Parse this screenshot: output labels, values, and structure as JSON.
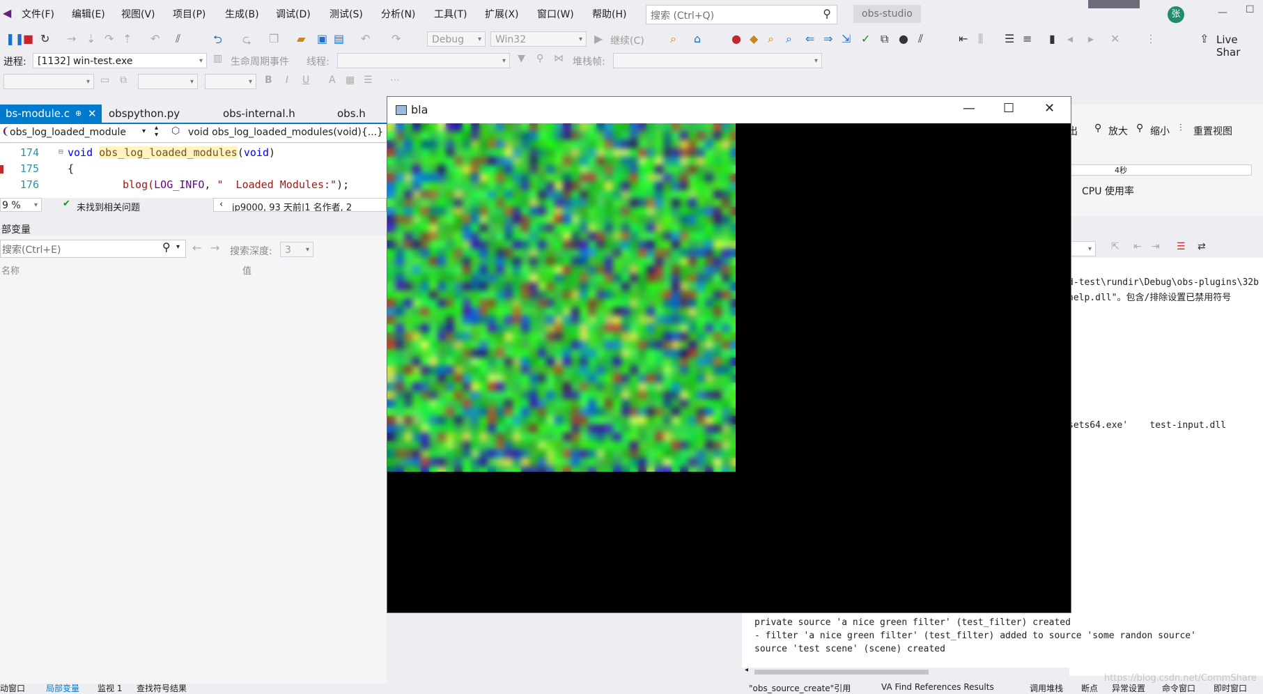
{
  "menu": {
    "items": [
      "文件(F)",
      "编辑(E)",
      "视图(V)",
      "项目(P)",
      "生成(B)",
      "调试(D)",
      "测试(S)",
      "分析(N)",
      "工具(T)",
      "扩展(X)",
      "窗口(W)",
      "帮助(H)"
    ],
    "search_placeholder": "搜索 (Ctrl+Q)",
    "solution": "obs-studio",
    "avatar": "张"
  },
  "toolbar": {
    "config": "Debug",
    "platform": "Win32",
    "continue": "继续(C)",
    "live_share": "Live Shar"
  },
  "procbar": {
    "process_label": "进程:",
    "process_value": "[1132] win-test.exe",
    "lifecycle": "生命周期事件",
    "thread_label": "线程:",
    "stack_label": "堆栈帧:"
  },
  "editor": {
    "tabs": [
      "bs-module.c",
      "obspython.py",
      "obs-internal.h",
      "obs.h"
    ],
    "nav_scope": "obs_log_loaded_module",
    "nav_member": "void obs_log_loaded_modules(void){...}",
    "lines": [
      {
        "num": "174"
      },
      {
        "num": "175"
      },
      {
        "num": "176"
      }
    ],
    "zoom": "9 %",
    "no_issues": "未找到相关问题",
    "blame": "jp9000, 93 天前|1 名作者, 2"
  },
  "code": {
    "l174_void": "void",
    "l174_fn": "obs_log_loaded_modules",
    "l174_paren_open": "(",
    "l174_void2": "void",
    "l174_paren_close": ")",
    "l175": "{",
    "l176_call": "blog(",
    "l176_macro": "LOG_INFO",
    "l176_comma": ", ",
    "l176_str": "\"  Loaded Modules:\"",
    "l176_end": ");"
  },
  "locals": {
    "title": "部变量",
    "search": "搜索(Ctrl+E)",
    "depth_label": "搜索深度:",
    "depth_value": "3",
    "col_name": "名称",
    "col_value": "值"
  },
  "diag": {
    "out_label": "出",
    "zoom_in": "放大",
    "zoom_out": "缩小",
    "reset_view": "重置视图",
    "time": "4秒",
    "cpu": "CPU 使用率"
  },
  "output": {
    "lines": [
      "d-test\\rundir\\Debug\\obs-plugins\\32b",
      "nelp.dll\"。包含/排除设置已禁用符号",
      "sets64.exe'    test-input.dll"
    ],
    "bottom_lines": [
      "private source 'a nice green filter' (test_filter) created",
      "- filter 'a nice green filter' (test_filter) added to source 'some randon source'",
      "source 'test scene' (scene) created"
    ]
  },
  "bottom_tabs": [
    "动窗口",
    "局部变量",
    "监视 1",
    "查找符号结果"
  ],
  "bottom_tabs_right": [
    "\"obs_source_create\"引用",
    "VA Find References Results",
    "调用堆栈",
    "断点",
    "异常设置",
    "命令窗口",
    "即时窗口"
  ],
  "watermark": "https://blog.csdn.net/CommShare",
  "window": {
    "title": "bla"
  },
  "colors": {
    "accent": "#007acc",
    "noise_main": "#2ad82a"
  }
}
